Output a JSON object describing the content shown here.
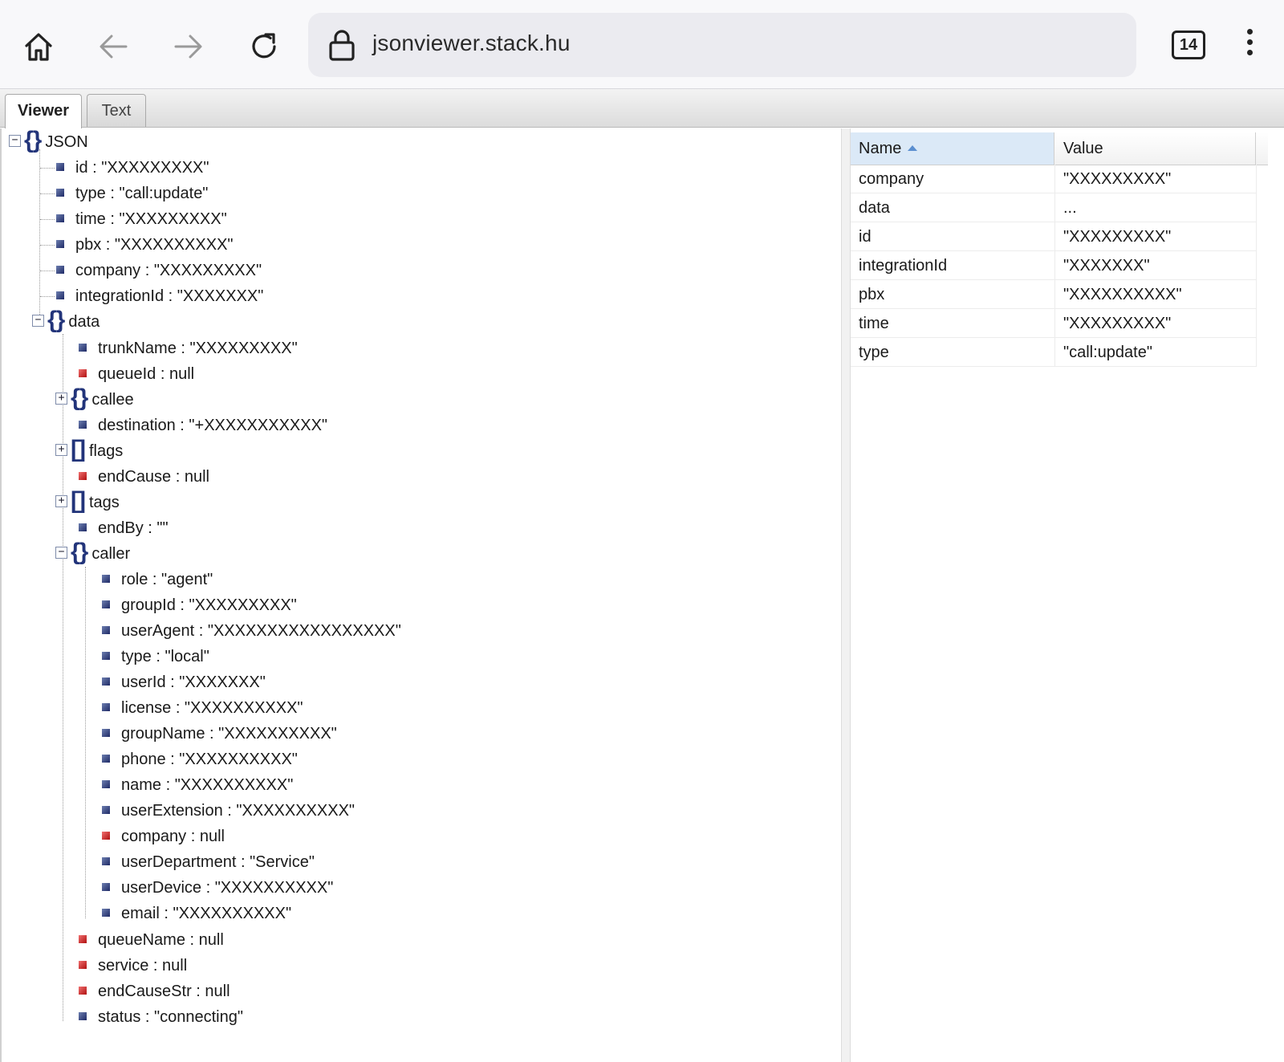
{
  "browser": {
    "url": "jsonviewer.stack.hu",
    "tab_count": "14"
  },
  "tabs": {
    "viewer": "Viewer",
    "text": "Text"
  },
  "tree": {
    "root": "JSON",
    "id": "id : \"XXXXXXXXX\"",
    "type": "type : \"call:update\"",
    "time": "time : \"XXXXXXXXX\"",
    "pbx": "pbx : \"XXXXXXXXXX\"",
    "company": "company : \"XXXXXXXXX\"",
    "integrationId": "integrationId : \"XXXXXXX\"",
    "data": "data",
    "trunkName": "trunkName : \"XXXXXXXXX\"",
    "queueId": "queueId : null",
    "callee": "callee",
    "destination": "destination : \"+XXXXXXXXXXX\"",
    "flags": "flags",
    "endCause": "endCause : null",
    "tags": "tags",
    "endBy": "endBy : \"\"",
    "caller": "caller",
    "role": "role : \"agent\"",
    "groupId": "groupId : \"XXXXXXXXX\"",
    "userAgent": "userAgent : \"XXXXXXXXXXXXXXXXX\"",
    "callerType": "type : \"local\"",
    "userId": "userId : \"XXXXXXX\"",
    "license": "license : \"XXXXXXXXXX\"",
    "groupName": "groupName : \"XXXXXXXXXX\"",
    "phone": "phone : \"XXXXXXXXXX\"",
    "name": "name : \"XXXXXXXXXX\"",
    "userExtension": "userExtension : \"XXXXXXXXXX\"",
    "callerCompany": "company : null",
    "userDepartment": "userDepartment : \"Service\"",
    "userDevice": "userDevice : \"XXXXXXXXXX\"",
    "email": "email : \"XXXXXXXXXX\"",
    "queueName": "queueName : null",
    "service": "service : null",
    "endCauseStr": "endCauseStr : null",
    "status": "status : \"connecting\""
  },
  "grid": {
    "col_name": "Name",
    "col_value": "Value",
    "rows": [
      {
        "name": "company",
        "value": "\"XXXXXXXXX\""
      },
      {
        "name": "data",
        "value": "..."
      },
      {
        "name": "id",
        "value": "\"XXXXXXXXX\""
      },
      {
        "name": "integrationId",
        "value": "\"XXXXXXX\""
      },
      {
        "name": "pbx",
        "value": "\"XXXXXXXXXX\""
      },
      {
        "name": "time",
        "value": "\"XXXXXXXXX\""
      },
      {
        "name": "type",
        "value": "\"call:update\""
      }
    ]
  },
  "icons": {
    "home": "home-icon",
    "back": "arrow-left-icon",
    "forward": "arrow-right-icon",
    "reload": "reload-icon",
    "lock": "lock-icon",
    "menu": "more-vertical-icon",
    "leaf": "leaf-node-icon",
    "null_leaf": "null-node-icon",
    "object": "object-braces-icon",
    "array": "array-brackets-icon"
  },
  "colors": {
    "value_node": "#1f2a66",
    "null_node": "#b01010",
    "brace": "#22347a",
    "sorted_header": "#dbe9f7"
  }
}
